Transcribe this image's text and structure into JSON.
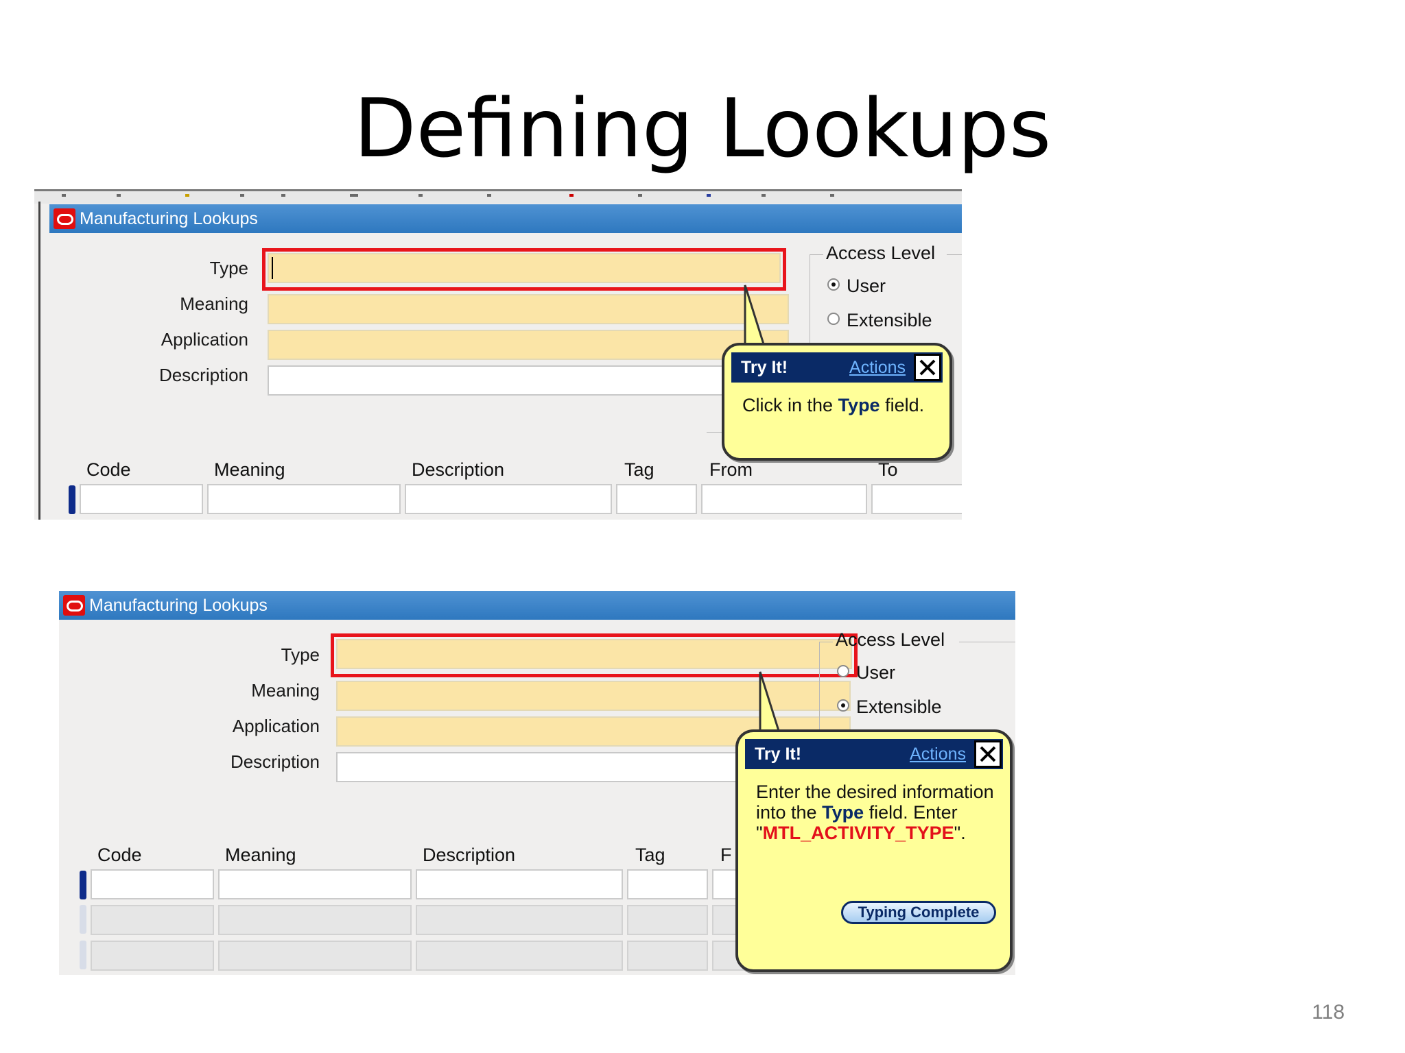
{
  "slide": {
    "title": "Defining Lookups",
    "page_number": "118"
  },
  "form": {
    "window_title": "Manufacturing Lookups",
    "labels": {
      "type": "Type",
      "meaning": "Meaning",
      "application": "Application",
      "description": "Description"
    },
    "access_level": {
      "title": "Access Level",
      "user": "User",
      "extensible": "Extensible"
    },
    "columns": [
      "Code",
      "Meaning",
      "Description",
      "Tag",
      "From",
      "To"
    ],
    "column_f_truncated": "F"
  },
  "step1": {
    "access_selected": "User",
    "callout": {
      "header": "Try It!",
      "actions": "Actions",
      "body_prefix": "Click in the ",
      "keyword": "Type",
      "body_suffix": " field."
    }
  },
  "step2": {
    "access_selected": "Extensible",
    "callout": {
      "header": "Try It!",
      "actions": "Actions",
      "body_prefix": "Enter the desired information into the ",
      "keyword": "Type",
      "body_mid": " field. Enter \"",
      "value": "MTL_ACTIVITY_TYPE",
      "body_suffix": "\".",
      "button": "Typing Complete"
    }
  },
  "colors": {
    "titlebar": "#2e78bf",
    "required_field": "#fbe5a7",
    "highlight": "#e8141b",
    "callout_bg": "#ffff99",
    "callout_header": "#0a2a66"
  },
  "icons": {
    "window": "oracle-icon",
    "close": "close-icon",
    "radio": "radio-button"
  }
}
